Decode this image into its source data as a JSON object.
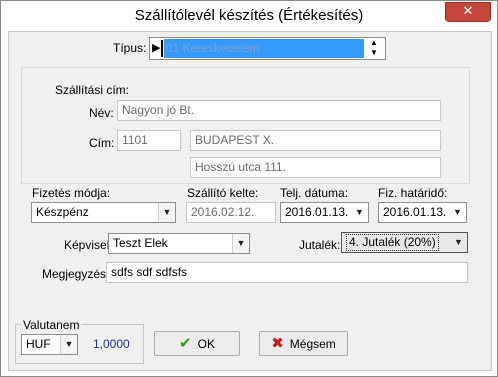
{
  "window": {
    "title": "Szállítólevél készítés (Értékesítés)",
    "close_glyph": "✕"
  },
  "type": {
    "label": "Típus:",
    "marker": "▶",
    "value": "01 Kereskedelem",
    "spin_up": "▲",
    "spin_down": "▼"
  },
  "address": {
    "section_label": "Szállítási cím:",
    "name_label": "Név:",
    "name_value": "Nagyon jó Bt.",
    "address_label": "Cím:",
    "zip_value": "1101",
    "city_value": "BUDAPEST X.",
    "street_value": "Hosszú utca 111."
  },
  "payment": {
    "label": "Fizetés módja:",
    "value": "Készpénz"
  },
  "ship_date": {
    "label": "Szállító kelte:",
    "value": "2016.02.12."
  },
  "fulfillment": {
    "label": "Telj. dátuma:",
    "value": "2016.01.13."
  },
  "deadline": {
    "label": "Fiz. határidő:",
    "value": "2016.01.13."
  },
  "rep": {
    "label": "Képviselő:",
    "value": "Teszt Elek"
  },
  "commission": {
    "label": "Jutalék:",
    "value": "4. Jutalék (20%)"
  },
  "note": {
    "label": "Megjegyzés:",
    "value": "sdfs sdf sdfsfs"
  },
  "currency": {
    "group_label": "Valutanem",
    "value": "HUF",
    "rate": "1,0000"
  },
  "buttons": {
    "ok_label": "OK",
    "ok_icon": "✔",
    "cancel_label": "Mégsem",
    "cancel_icon": "✖"
  },
  "dropdown_arrow": "▼",
  "colors": {
    "selection": "#3399ff",
    "ok_green": "#2a9a1c",
    "cancel_red": "#c81a1a",
    "rate_blue": "#1a2fa8"
  }
}
